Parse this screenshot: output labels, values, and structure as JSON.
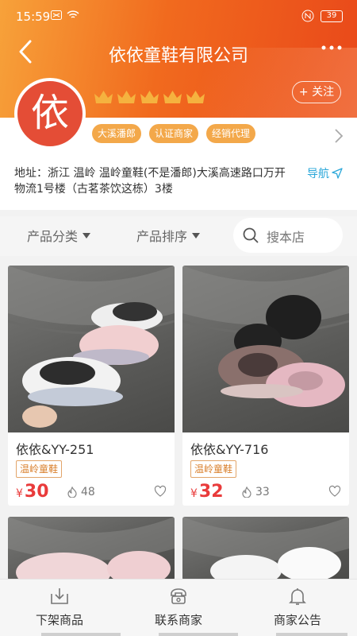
{
  "status_bar": {
    "time": "15:59",
    "battery": "39"
  },
  "header": {
    "title": "依依童鞋有限公司",
    "more": "•••"
  },
  "store": {
    "logo_char": "依",
    "follow_label": "+ 关注",
    "tags": [
      "大溪潘郎",
      "认证商家",
      "经销代理"
    ],
    "address": "地址：浙江 温岭 温岭童鞋(不是潘郎)大溪高速路口万开物流1号楼（古茗茶饮这栋）3楼",
    "navigate_label": "导航"
  },
  "filters": {
    "category_label": "产品分类",
    "sort_label": "产品排序",
    "search_placeholder": "搜本店"
  },
  "products": [
    {
      "name": "依依&YY-251",
      "tag": "温岭童鞋",
      "currency": "¥",
      "price": "30",
      "likes": "48"
    },
    {
      "name": "依依&YY-716",
      "tag": "温岭童鞋",
      "currency": "¥",
      "price": "32",
      "likes": "33"
    }
  ],
  "bottom_bar": {
    "items": [
      {
        "label": "下架商品",
        "icon": "download-icon"
      },
      {
        "label": "联系商家",
        "icon": "phone-icon"
      },
      {
        "label": "商家公告",
        "icon": "bell-icon"
      }
    ]
  },
  "colors": {
    "header_orange": "#f16a1e",
    "tag_orange": "#f3a84a",
    "price_red": "#e93b3b",
    "navigate_blue": "#2aa7d9"
  }
}
